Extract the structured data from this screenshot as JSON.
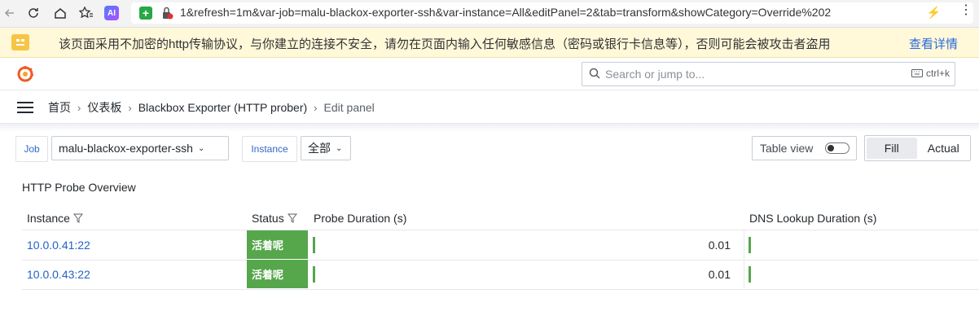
{
  "browser": {
    "url": "1&refresh=1m&var-job=malu-blackox-exporter-ssh&var-instance=All&editPanel=2&tab=transform&showCategory=Override%202",
    "ai_badge": "AI"
  },
  "warning": {
    "message": "该页面采用不加密的http传输协议，与你建立的连接不安全，请勿在页面内输入任何敏感信息（密码或银行卡信息等），否则可能会被攻击者盗用",
    "link": "查看详情"
  },
  "topnav": {
    "search_placeholder": "Search or jump to...",
    "shortcut": "ctrl+k"
  },
  "breadcrumb": {
    "items": [
      "首页",
      "仪表板",
      "Blackbox Exporter (HTTP prober)",
      "Edit panel"
    ]
  },
  "variables": {
    "job_label": "Job",
    "job_value": "malu-blackox-exporter-ssh",
    "instance_label": "Instance",
    "instance_value": "全部"
  },
  "controls": {
    "table_view": "Table view",
    "fill": "Fill",
    "actual": "Actual"
  },
  "panel": {
    "title": "HTTP Probe Overview",
    "columns": [
      "Instance",
      "Status",
      "Probe Duration (s)",
      "DNS Lookup Duration (s)"
    ],
    "rows": [
      {
        "instance": "10.0.0.41:22",
        "status": "活着呢",
        "probe_duration": "0.01"
      },
      {
        "instance": "10.0.0.43:22",
        "status": "活着呢",
        "probe_duration": "0.01"
      }
    ]
  },
  "colors": {
    "status_green": "#56a64b",
    "link_blue": "#2461c6",
    "warning_bg": "#fff8d9"
  }
}
